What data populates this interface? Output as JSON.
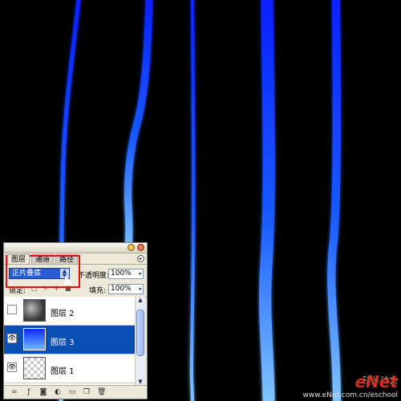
{
  "panel": {
    "tabs": [
      "图层",
      "通道",
      "路径"
    ],
    "blend_mode": "正片叠底",
    "opacity_label": "不透明度:",
    "opacity_value": "100%",
    "lock_label": "锁定:",
    "fill_label": "填充:",
    "fill_value": "100%",
    "layers": [
      {
        "name": "图层 2",
        "visible": false,
        "selected": false,
        "thumb": "clouds"
      },
      {
        "name": "图层 3",
        "visible": true,
        "selected": true,
        "thumb": "blue"
      },
      {
        "name": "图层 1",
        "visible": true,
        "selected": false,
        "thumb": "checker"
      }
    ]
  },
  "watermark": {
    "logo": "eNet",
    "chinese": "硅谷动力",
    "url": "www.eNet.com.cn/eschool"
  },
  "colors": {
    "background": "#000000",
    "glow": "#1a3cff",
    "glow_light": "#6fb8ff",
    "selection": "#0a4fb4",
    "highlight": "#e01010"
  },
  "icons": {
    "panel_menu": "panel-menu-icon",
    "eye": "eye-icon",
    "lock": "lock-icon"
  }
}
